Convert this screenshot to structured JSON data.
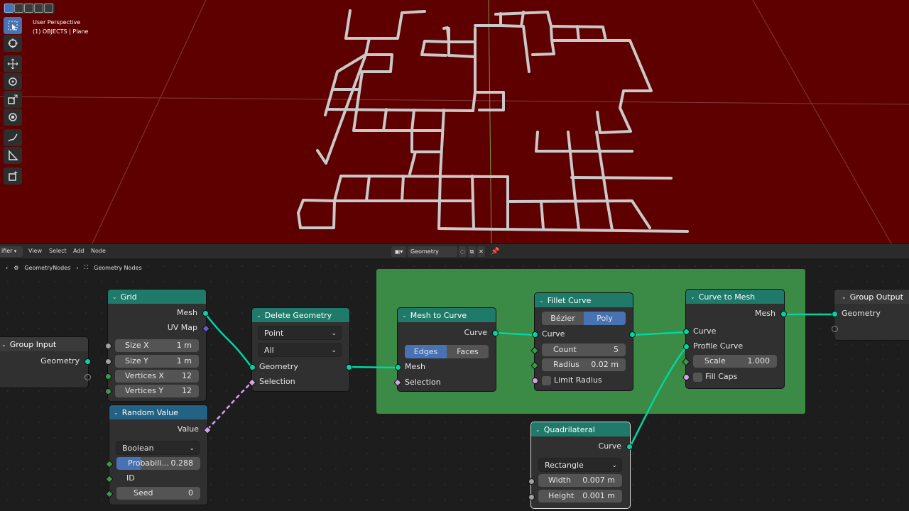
{
  "viewport": {
    "perspective_label": "User Perspective",
    "object_label": "(1) OBJECTS | Plane",
    "background_color": "#5e0000",
    "mode_buttons": [
      "select-box-mode",
      "extend-mode",
      "subtract-mode",
      "difference-mode",
      "intersect-mode"
    ],
    "tools": [
      "select-box-icon",
      "cursor-icon",
      "move-icon",
      "rotate-icon",
      "scale-icon",
      "transform-icon",
      "annotate-icon",
      "measure-icon",
      "add-cube-icon"
    ]
  },
  "node_editor": {
    "header": {
      "editor_type": "ifier",
      "menus": [
        "View",
        "Select",
        "Add",
        "Node"
      ],
      "tree_name": "Geometry Nodes"
    },
    "breadcrumb": [
      "GeometryNodes",
      "Geometry Nodes"
    ],
    "nodes": {
      "group_input": {
        "title": "Group Input",
        "out_geometry": "Geometry"
      },
      "grid": {
        "title": "Grid",
        "out_mesh": "Mesh",
        "out_uv": "UV Map",
        "size_x_label": "Size X",
        "size_x": "1 m",
        "size_y_label": "Size Y",
        "size_y": "1 m",
        "vx_label": "Vertices X",
        "vx": "12",
        "vy_label": "Vertices Y",
        "vy": "12"
      },
      "random_value": {
        "title": "Random Value",
        "out_value": "Value",
        "type": "Boolean",
        "prob_label": "Probabili...",
        "prob": "0.288",
        "id_label": "ID",
        "seed_label": "Seed",
        "seed": "0"
      },
      "delete_geometry": {
        "title": "Delete Geometry",
        "domain": "Point",
        "mode": "All",
        "in_geometry": "Geometry",
        "in_selection": "Selection"
      },
      "mesh_to_curve": {
        "title": "Mesh to Curve",
        "out_curve": "Curve",
        "mode_a": "Edges",
        "mode_b": "Faces",
        "in_mesh": "Mesh",
        "in_selection": "Selection"
      },
      "fillet_curve": {
        "title": "Fillet Curve",
        "mode_a": "Bézier",
        "mode_b": "Poly",
        "in_curve": "Curve",
        "count_label": "Count",
        "count": "5",
        "radius_label": "Radius",
        "radius": "0.02 m",
        "limit_label": "Limit Radius"
      },
      "curve_to_mesh": {
        "title": "Curve to Mesh",
        "out_mesh": "Mesh",
        "in_curve": "Curve",
        "in_profile": "Profile Curve",
        "scale_label": "Scale",
        "scale": "1.000",
        "fill_caps": "Fill Caps"
      },
      "quadrilateral": {
        "title": "Quadrilateral",
        "out_curve": "Curve",
        "type": "Rectangle",
        "width_label": "Width",
        "width": "0.007 m",
        "height_label": "Height",
        "height": "0.001 m"
      },
      "group_output": {
        "title": "Group Output",
        "in_geometry": "Geometry"
      }
    },
    "colors": {
      "geometry_header": "#1f7a69",
      "utility_header": "#246283",
      "frame": "#3b8a45",
      "geometry_socket": "#00d6a3"
    }
  }
}
